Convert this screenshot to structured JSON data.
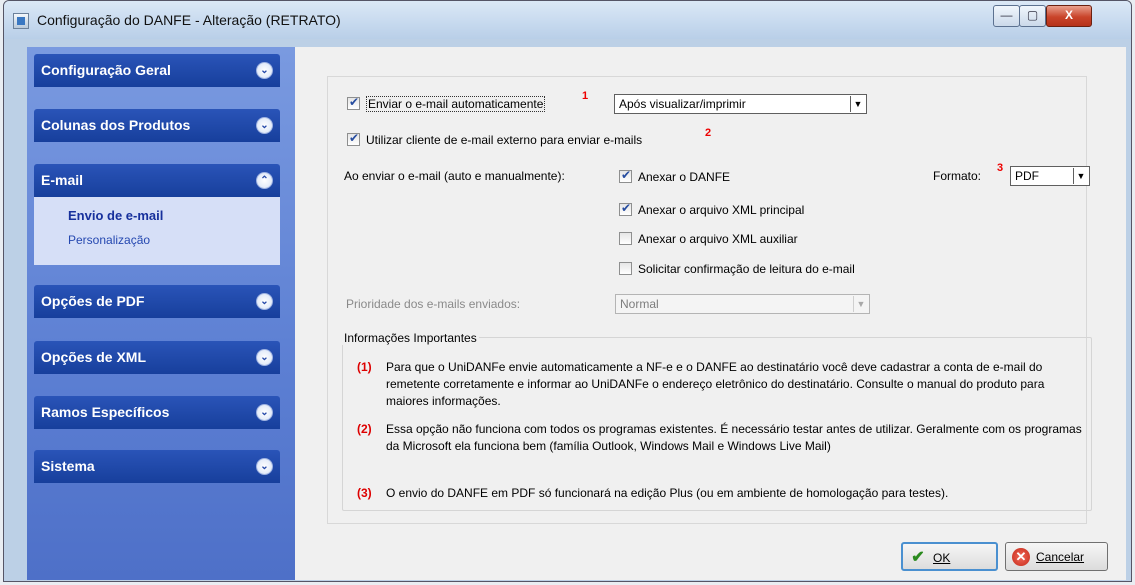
{
  "window": {
    "title": "Configuração do DANFE - Alteração  (RETRATO)",
    "controls": {
      "minimize": "—",
      "maximize": "▢",
      "close": "X"
    }
  },
  "sidebar": {
    "groups": [
      {
        "label": "Configuração Geral",
        "chevron": "⌄",
        "expanded": false
      },
      {
        "label": "Colunas dos Produtos",
        "chevron": "⌄",
        "expanded": false
      },
      {
        "label": "E-mail",
        "chevron": "⌃",
        "expanded": true,
        "items": [
          {
            "label": "Envio de e-mail",
            "active": true
          },
          {
            "label": "Personalização",
            "active": false
          }
        ]
      },
      {
        "label": "Opções de PDF",
        "chevron": "⌄",
        "expanded": false
      },
      {
        "label": "Opções de XML",
        "chevron": "⌄",
        "expanded": false
      },
      {
        "label": "Ramos Específicos",
        "chevron": "⌄",
        "expanded": false
      },
      {
        "label": "Sistema",
        "chevron": "⌄",
        "expanded": false
      }
    ]
  },
  "form": {
    "auto_send": {
      "label": "Enviar o e-mail automaticamente",
      "checked": true,
      "note": "1"
    },
    "auto_send_when": {
      "value": "Após visualizar/imprimir"
    },
    "external_client": {
      "label": "Utilizar cliente de e-mail externo para enviar e-mails",
      "checked": true,
      "note": "2"
    },
    "on_send_label": "Ao enviar o e-mail (auto e manualmente):",
    "attach_danfe": {
      "label": "Anexar o DANFE",
      "checked": true
    },
    "format": {
      "label": "Formato:",
      "note": "3",
      "value": "PDF"
    },
    "attach_xml_main": {
      "label": "Anexar o arquivo XML principal",
      "checked": true
    },
    "attach_xml_aux": {
      "label": "Anexar o arquivo XML auxiliar",
      "checked": false
    },
    "read_receipt": {
      "label": "Solicitar confirmação de leitura do e-mail",
      "checked": false
    },
    "priority": {
      "label": "Prioridade dos e-mails enviados:",
      "value": "Normal"
    }
  },
  "info": {
    "title": "Informações Importantes",
    "notes": [
      {
        "num": "(1)",
        "text": "Para que o UniDANFe envie automaticamente a NF-e e o DANFE ao destinatário você deve cadastrar a conta de e-mail do remetente corretamente e informar ao UniDANFe o endereço eletrônico do destinatário. Consulte o manual do produto para maiores informações."
      },
      {
        "num": "(2)",
        "text": "Essa opção não funciona com todos os programas existentes. É necessário testar antes de utilizar. Geralmente com os programas da Microsoft ela funciona bem (família Outlook, Windows Mail e Windows Live Mail)"
      },
      {
        "num": "(3)",
        "text": "O envio do DANFE em PDF só funcionará na edição Plus (ou em ambiente de homologação para testes)."
      }
    ]
  },
  "buttons": {
    "ok": {
      "label": "OK",
      "icon": "✔"
    },
    "cancel": {
      "label": "Cancelar",
      "icon": "✕"
    }
  },
  "colors": {
    "sidebar_header": "#1f4aa8",
    "sidebar_bg": "#5c7fd3",
    "accent_red": "#e00000"
  }
}
